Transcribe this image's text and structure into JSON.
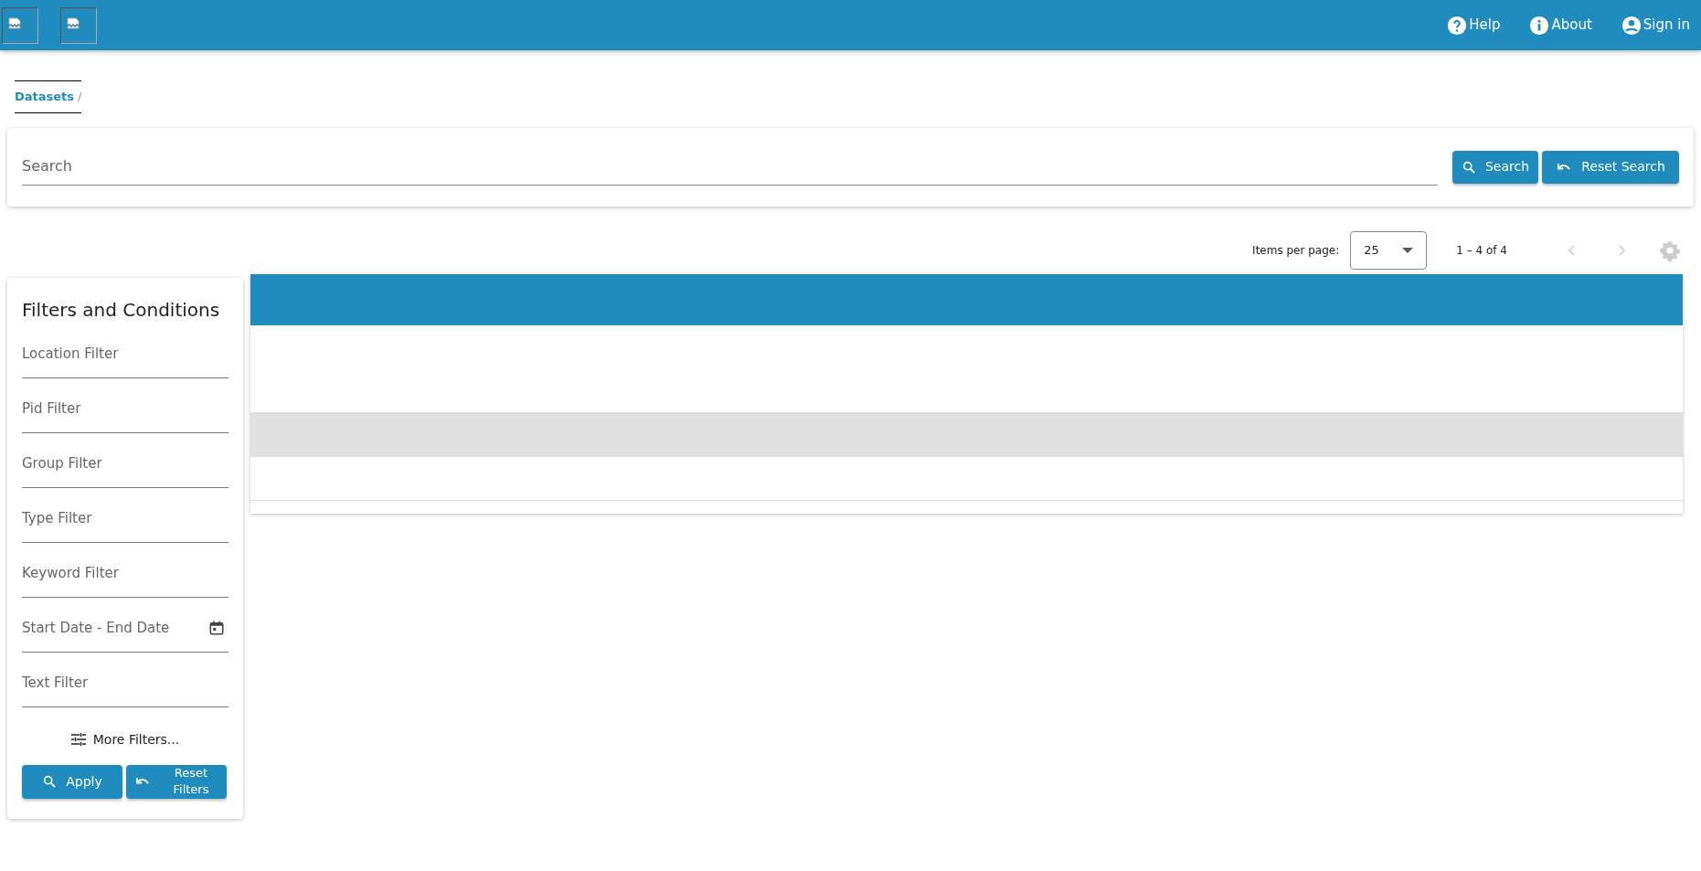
{
  "header": {
    "logos": [
      {
        "kind": "broken-image"
      },
      {
        "kind": "broken-image"
      }
    ],
    "nav": [
      {
        "kind": "help",
        "label": "Help"
      },
      {
        "kind": "about",
        "label": "About"
      },
      {
        "kind": "user",
        "label": "Sign in"
      }
    ]
  },
  "breadcrumb": [
    "Datasets"
  ],
  "breadcrumb_separator": "/",
  "search": {
    "placeholder": "Search",
    "buttons": [
      {
        "kind": "search",
        "label": "Search"
      },
      {
        "kind": "reset",
        "label": "Reset Search"
      }
    ]
  },
  "paginator": {
    "label": "Items per page:",
    "page_size": "25",
    "range": "1 – 4 of 4",
    "prev_disabled": true,
    "next_disabled": true
  },
  "filters": {
    "title": "Filters and Conditions",
    "fields": [
      {
        "kind": "text",
        "placeholder": "Location Filter"
      },
      {
        "kind": "text",
        "placeholder": "Pid Filter"
      },
      {
        "kind": "text",
        "placeholder": "Group Filter"
      },
      {
        "kind": "text",
        "placeholder": "Type Filter"
      },
      {
        "kind": "text",
        "placeholder": "Keyword Filter"
      },
      {
        "kind": "date",
        "placeholder": "Start Date - End Date"
      },
      {
        "kind": "text",
        "placeholder": "Text Filter"
      }
    ],
    "more": "More Filters...",
    "buttons": [
      {
        "kind": "search",
        "label": "Apply"
      },
      {
        "kind": "reset",
        "label": "Reset Filters"
      }
    ]
  },
  "table": {
    "rows": [
      {
        "highlighted": false,
        "tall": true
      },
      {
        "highlighted": true,
        "tall": false
      },
      {
        "highlighted": false,
        "tall": false
      }
    ]
  }
}
